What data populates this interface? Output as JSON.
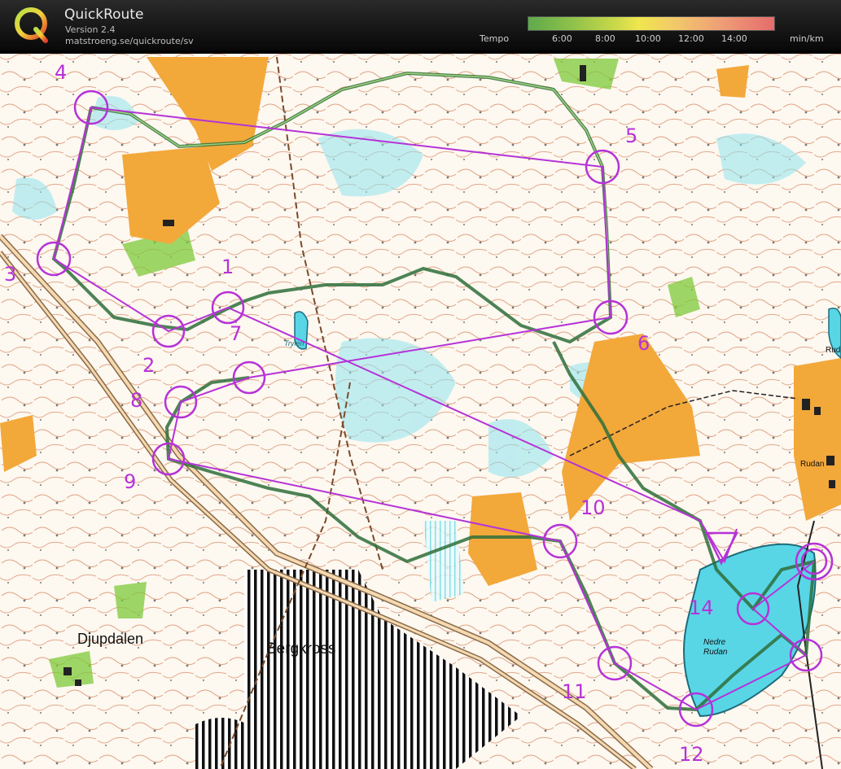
{
  "app": {
    "name": "QuickRoute",
    "version": "Version 2.4",
    "url": "matstroeng.se/quickroute/sv",
    "logo_letter": "Q"
  },
  "tempo_legend": {
    "label": "Tempo",
    "ticks": [
      "6:00",
      "8:00",
      "10:00",
      "12:00",
      "14:00"
    ],
    "unit": "min/km",
    "colors": [
      "#5eaa4c",
      "#c8d84a",
      "#f0e64e",
      "#ee9f77",
      "#e56c6c"
    ]
  },
  "map": {
    "place_labels": {
      "djupdalen": "Djupdalen",
      "bergkross": "Bergkross",
      "nedre": "Nedre",
      "rudan_lake": "Rudan",
      "rudan_town": "Rudan",
      "trylen": "Trylen",
      "ruda_edge": "Rud"
    },
    "controls": [
      "1",
      "2",
      "3",
      "4",
      "5",
      "6",
      "7",
      "8",
      "9",
      "10",
      "11",
      "12",
      "14"
    ],
    "colors": {
      "course": "#b632d8",
      "contour": "#c65a28",
      "open_land": "#f3a83a",
      "water": "#58d6e6",
      "route": "#2e6e3a"
    }
  }
}
